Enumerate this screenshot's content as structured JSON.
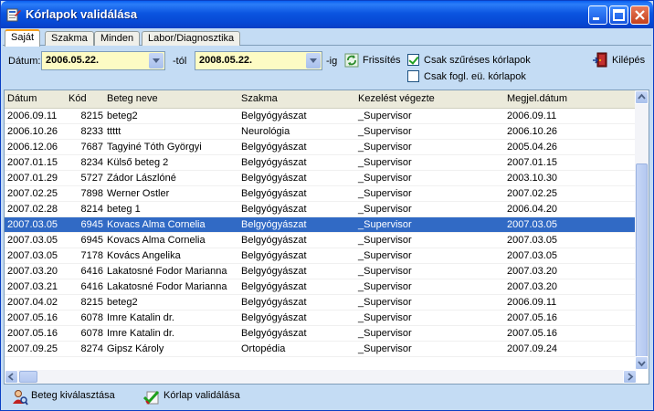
{
  "window": {
    "title": "Kórlapok validálása"
  },
  "tabs": [
    {
      "label": "Saját"
    },
    {
      "label": "Szakma"
    },
    {
      "label": "Minden"
    },
    {
      "label": "Labor/Diagnosztika"
    }
  ],
  "filter": {
    "date_label": "Dátum:",
    "date_from": "2006.05.22.",
    "from_suffix": "-tól",
    "date_to": "2008.05.22.",
    "to_suffix": "-ig",
    "refresh_label": "Frissítés",
    "chk_filtered_label": "Csak szűréses kórlapok",
    "chk_filtered_checked": true,
    "chk_occupational_label": "Csak fogl. eü. kórlapok",
    "chk_occupational_checked": false,
    "exit_label": "Kilépés"
  },
  "table": {
    "columns": [
      "Dátum",
      "Kód",
      "Beteg neve",
      "Szakma",
      "Kezelést végezte",
      "Megjel.dátum"
    ],
    "selected_index": 7,
    "rows": [
      [
        "2006.09.11",
        "8215",
        "beteg2",
        "Belgyógyászat",
        "_Supervisor",
        "2006.09.11"
      ],
      [
        "2006.10.26",
        "8233",
        "ttttt",
        "Neurológia",
        "_Supervisor",
        "2006.10.26"
      ],
      [
        "2006.12.06",
        "7687",
        "Tagyiné Tóth Györgyi",
        "Belgyógyászat",
        "_Supervisor",
        "2005.04.26"
      ],
      [
        "2007.01.15",
        "8234",
        "Külső beteg 2",
        "Belgyógyászat",
        "_Supervisor",
        "2007.01.15"
      ],
      [
        "2007.01.29",
        "5727",
        "Zádor Lászlóné",
        "Belgyógyászat",
        "_Supervisor",
        "2003.10.30"
      ],
      [
        "2007.02.25",
        "7898",
        "Werner  Ostler",
        "Belgyógyászat",
        "_Supervisor",
        "2007.02.25"
      ],
      [
        "2007.02.28",
        "8214",
        "beteg 1",
        "Belgyógyászat",
        "_Supervisor",
        "2006.04.20"
      ],
      [
        "2007.03.05",
        "6945",
        "Kovacs Alma Cornelia",
        "Belgyógyászat",
        "_Supervisor",
        "2007.03.05"
      ],
      [
        "2007.03.05",
        "6945",
        "Kovacs Alma Cornelia",
        "Belgyógyászat",
        "_Supervisor",
        "2007.03.05"
      ],
      [
        "2007.03.05",
        "7178",
        "Kovács Angelika",
        "Belgyógyászat",
        "_Supervisor",
        "2007.03.05"
      ],
      [
        "2007.03.20",
        "6416",
        "Lakatosné Fodor Marianna",
        "Belgyógyászat",
        "_Supervisor",
        "2007.03.20"
      ],
      [
        "2007.03.21",
        "6416",
        "Lakatosné Fodor Marianna",
        "Belgyógyászat",
        "_Supervisor",
        "2007.03.20"
      ],
      [
        "2007.04.02",
        "8215",
        "beteg2",
        "Belgyógyászat",
        "_Supervisor",
        "2006.09.11"
      ],
      [
        "2007.05.16",
        "6078",
        "Imre Katalin dr.",
        "Belgyógyászat",
        "_Supervisor",
        "2007.05.16"
      ],
      [
        "2007.05.16",
        "6078",
        "Imre Katalin dr.",
        "Belgyógyászat",
        "_Supervisor",
        "2007.05.16"
      ],
      [
        "2007.09.25",
        "8274",
        "Gipsz Károly",
        "Ortopédia",
        "_Supervisor",
        "2007.09.24"
      ]
    ]
  },
  "status": {
    "select_patient_label": "Beteg kiválasztása",
    "validate_label": "Kórlap validálása"
  },
  "colors": {
    "titlebar": "#0a5ff0",
    "selection": "#316ac5",
    "date_field_bg": "#fdfbc4",
    "panel_bg": "#c4dcf4"
  },
  "icons": {
    "title": "records-icon",
    "refresh": "refresh-icon",
    "exit": "exit-door-icon",
    "select_patient": "patient-icon",
    "validate": "checkmark-icon"
  }
}
